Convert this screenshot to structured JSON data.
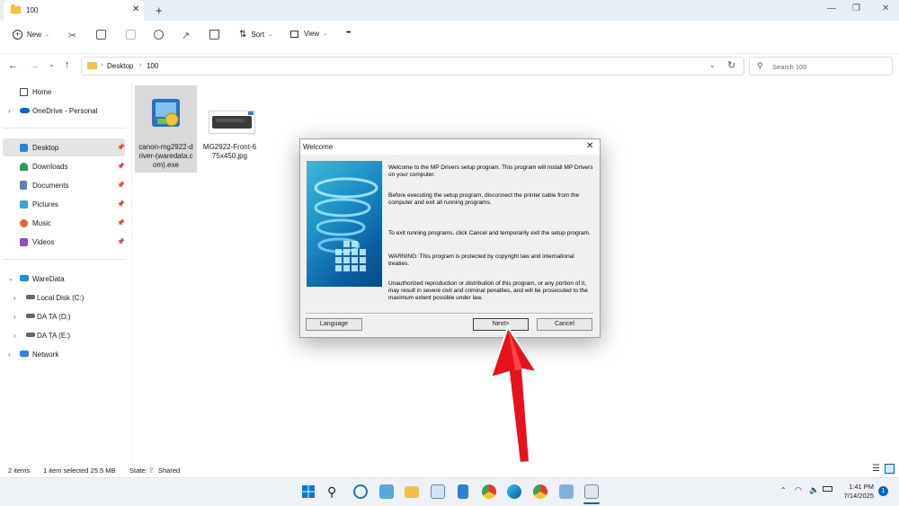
{
  "tab": {
    "title": "100",
    "close": "✕",
    "new": "+"
  },
  "window_controls": {
    "minimize": "—",
    "maximize": "❐",
    "close": "✕"
  },
  "toolbar": {
    "new_label": "New",
    "sort_label": "Sort",
    "view_label": "View",
    "more": "•••"
  },
  "address": {
    "segments": [
      "Desktop",
      "100"
    ],
    "search_placeholder": "Search 100"
  },
  "sidebar": {
    "home": "Home",
    "onedrive": "OneDrive - Personal",
    "quick": [
      {
        "label": "Desktop",
        "color": "#2f7fd8"
      },
      {
        "label": "Downloads",
        "color": "#2a9d4f"
      },
      {
        "label": "Documents",
        "color": "#5b7fb8"
      },
      {
        "label": "Pictures",
        "color": "#3aa3d8"
      },
      {
        "label": "Music",
        "color": "#e0683a"
      },
      {
        "label": "Videos",
        "color": "#8a4bc9"
      }
    ],
    "pc": "WareData",
    "drives": [
      "Local Disk (C:)",
      "DA TA (D:)",
      "DA TA (E:)"
    ],
    "network": "Network"
  },
  "files": [
    {
      "name": "canon-mg2922-driver-(waredata.com).exe",
      "line1": "canon-mg2922-d",
      "line2": "river-(waredata.c",
      "line3": "om).exe"
    },
    {
      "name": "MG2922-Front-675x450.jpg",
      "line1": "MG2922-Front-6",
      "line2": "75x450.jpg"
    }
  ],
  "dialog": {
    "title": "Welcome",
    "close": "✕",
    "p1": "Welcome to the MP Drivers setup program. This program will install MP Drivers on your computer.",
    "p2": "Before executing the setup program, disconnect the printer cable from the computer and exit all running programs.",
    "p3": "To exit running programs, click Cancel and temporarily exit the setup program.",
    "p4": "WARNING: This program is protected by copyright law and international treaties.",
    "p5": "Unauthorized reproduction or distribution of this program, or any portion of it, may result in severe civil and criminal penalties, and will be prosecuted to the maximum extent possible under law.",
    "language_btn": "Language",
    "next_btn": "Next>",
    "cancel_btn": "Cancel"
  },
  "status": {
    "items": "2 items",
    "selected": "1 item selected  25.5 MB",
    "state_label": "State:",
    "state_value": "Shared"
  },
  "clock": {
    "time": "1:41 PM",
    "date": "7/14/2025"
  },
  "notification_count": "1",
  "colors": {
    "accent": "#0067c0",
    "arrow": "#e8121a",
    "selection": "#cce4f7"
  }
}
